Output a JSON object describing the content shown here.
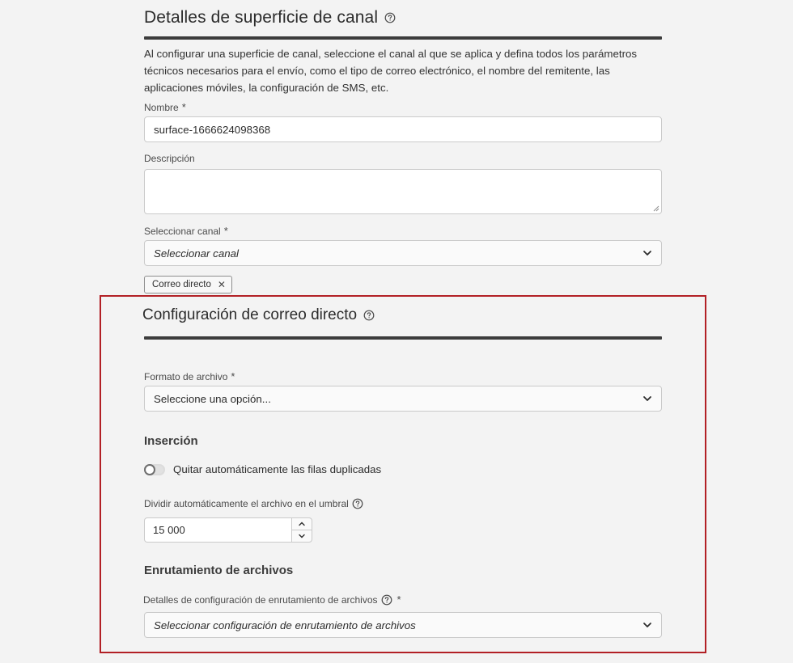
{
  "surface": {
    "title": "Detalles de superficie de canal",
    "description": "Al configurar una superficie de canal, seleccione el canal al que se aplica y defina todos los parámetros técnicos necesarios para el envío, como el tipo de correo electrónico, el nombre del remitente, las aplicaciones móviles, la configuración de SMS, etc.",
    "name_label": "Nombre",
    "name_value": "surface-1666624098368",
    "description_label": "Descripción",
    "description_value": "",
    "channel_label": "Seleccionar canal",
    "channel_placeholder": "Seleccionar canal",
    "selected_tag": "Correo directo",
    "tag_remove": "✕",
    "required_mark": "*"
  },
  "direct_mail": {
    "title": "Configuración de correo directo",
    "file_format_label": "Formato de archivo",
    "file_format_placeholder": "Seleccione una opción...",
    "insertion_heading": "Inserción",
    "dedupe_toggle_label": "Quitar automáticamente las filas duplicadas",
    "dedupe_enabled": false,
    "split_label": "Dividir automáticamente el archivo en el umbral",
    "split_value": "15 000",
    "routing_heading": "Enrutamiento de archivos",
    "routing_label": "Detalles de configuración de enrutamiento de archivos",
    "routing_placeholder": "Seleccionar configuración de enrutamiento de archivos"
  },
  "colors": {
    "highlight_border": "#b22025",
    "background": "#f3f3f3"
  },
  "icons": {
    "help": "help-circle-icon",
    "dropdown": "chevron-down-icon",
    "remove": "close-icon",
    "step_up": "chevron-up-icon",
    "step_down": "chevron-down-icon"
  }
}
